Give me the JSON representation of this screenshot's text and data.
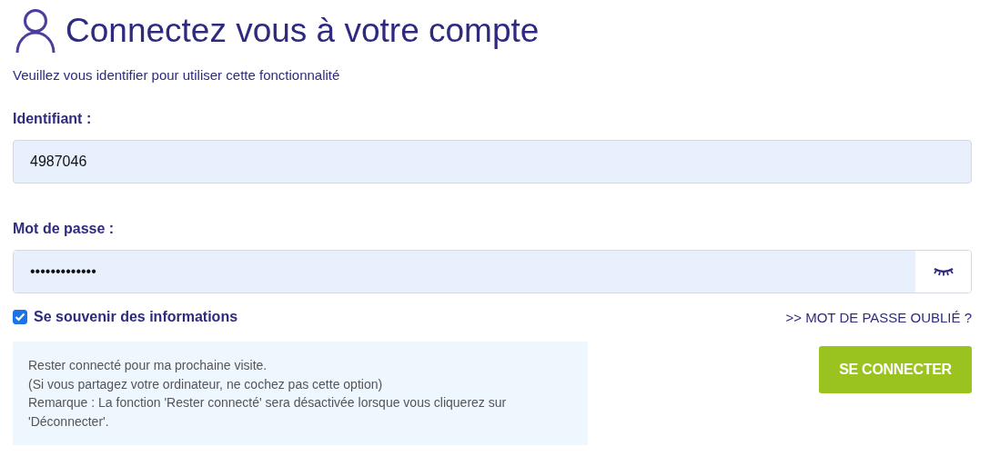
{
  "title": "Connectez vous à votre compte",
  "subtitle": "Veuillez vous identifier pour utiliser cette fonctionnalité",
  "username": {
    "label": "Identifiant :",
    "value": "4987046"
  },
  "password": {
    "label": "Mot de passe :",
    "value": "•••••••••••••"
  },
  "remember": {
    "label": "Se souvenir des informations",
    "checked": true
  },
  "forgot_link": ">> MOT DE PASSE OUBLIÉ ?",
  "info": [
    "Rester connecté pour ma prochaine visite.",
    "(Si vous partagez votre ordinateur, ne cochez pas cette option)",
    "Remarque : La fonction 'Rester connecté' sera désactivée lorsque vous cliquerez sur 'Déconnecter'."
  ],
  "submit": "SE CONNECTER"
}
